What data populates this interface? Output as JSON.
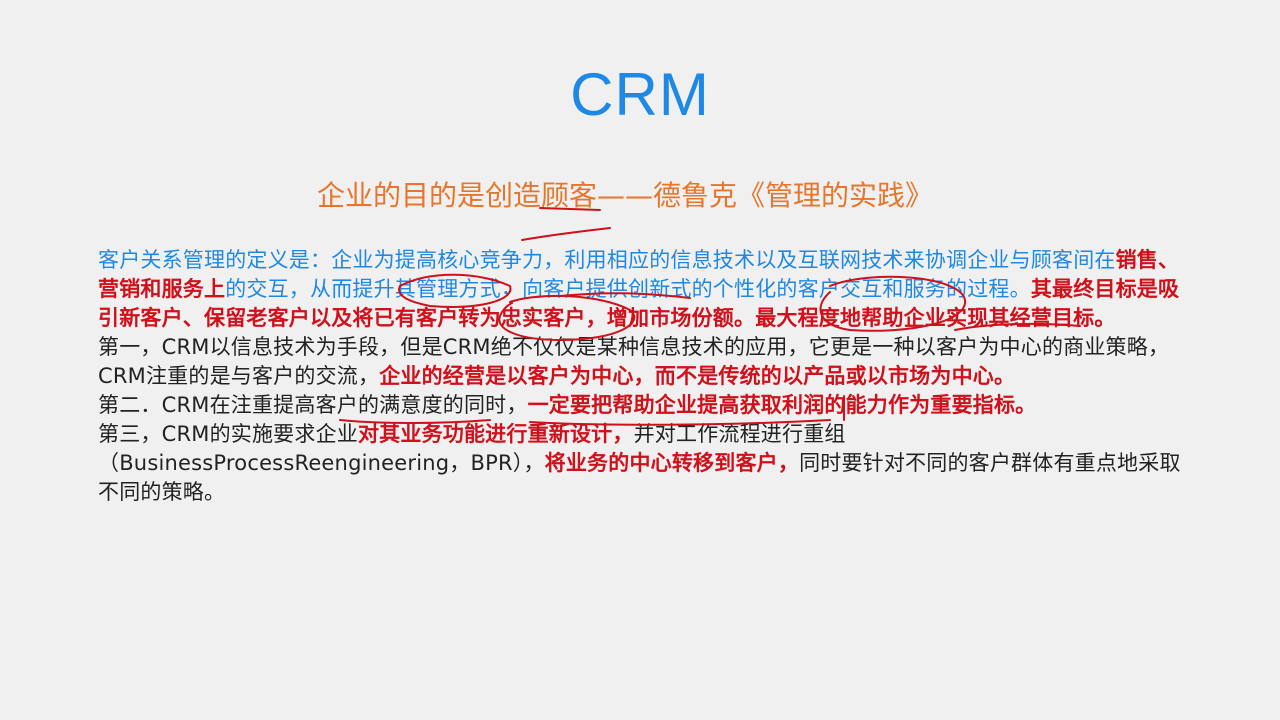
{
  "slide": {
    "title": "CRM",
    "subtitle": "企业的目的是创造顾客——德鲁克《管理的实践》"
  },
  "definition": {
    "part1": "客户关系管理的定义是：企业为提高核心竞争力，利用相应的信息技术以及互联网技术来协调企业与顾客间在",
    "part2": "销售、营销和服务上",
    "part3": "的交互，从而提升其管理方式，向客户提供创新式的个性化的客户交互和服务的过程。",
    "part4": "其最终目标是吸引新客户、保留老客户以及将已有客户转为忠实客户，增加市场份额。最大程度地帮助企业实现其经营目标。"
  },
  "point1": {
    "part1": "第一，CRM以信息技术为手段，但是CRM绝不仅仅是某种信息技术的应用，它更是一种以客户为中心的商业策略，CRM注重的是与客户的交流，",
    "part2": "企业的经营是以客户为中心，而不是传统的以产品或以市场为中心。"
  },
  "point2": {
    "part1": "第二．CRM在注重提高客户的满意度的同时，",
    "part2": "一定要把帮助企业提高获取利润的能力作为重要指标。"
  },
  "point3": {
    "part1": "第三，CRM的实施要求企业",
    "part2": "对其业务功能进行重新设计，",
    "part3": "并对工作流程进行重组（BusinessProcessReengineering，BPR），",
    "part4": "将业务的中心转移到客户，",
    "part5": "同时要针对不同的客户群体有重点地采取不同的策略。"
  },
  "colors": {
    "title": "#1e88e5",
    "subtitle": "#e6762b",
    "definition": "#1e88e5",
    "emphasis": "#d0101b",
    "annotation": "#d0101b"
  }
}
